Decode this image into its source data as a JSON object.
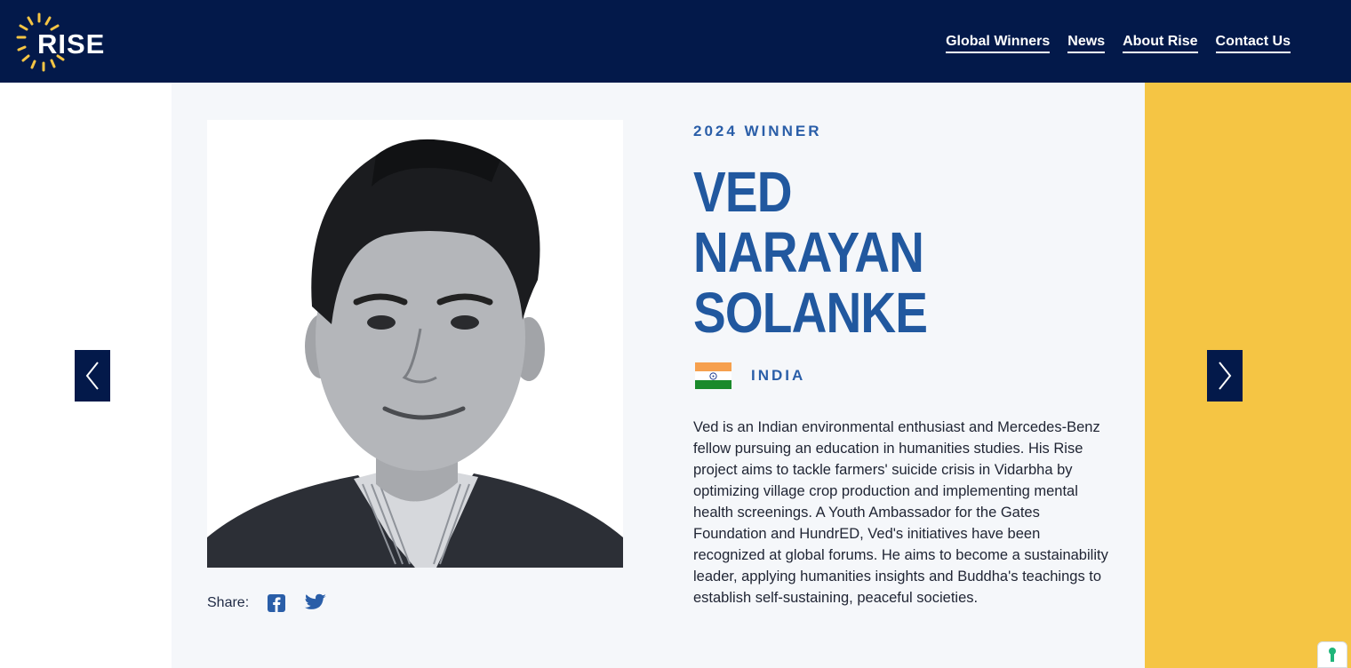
{
  "brand": {
    "logo_text": "RISE",
    "colors": {
      "navy": "#03194a",
      "blue": "#21589f",
      "yellow": "#f5c544",
      "panel": "#f5f7fa"
    }
  },
  "nav": {
    "items": [
      {
        "label": "Global Winners"
      },
      {
        "label": "News"
      },
      {
        "label": "About Rise"
      },
      {
        "label": "Contact Us"
      }
    ]
  },
  "profile": {
    "winner_tag": "2024 WINNER",
    "name_lines": [
      "VED",
      "NARAYAN",
      "SOLANKE"
    ],
    "country": "INDIA",
    "bio": "Ved is an Indian environmental enthusiast and Mercedes-Benz fellow pursuing an education in humanities studies. His Rise project aims to tackle farmers' suicide crisis in Vidarbha by optimizing village crop production and implementing mental health screenings. A Youth Ambassador for the Gates Foundation and HundrED, Ved's initiatives have been recognized at global forums. He aims to become a sustainability leader, applying humanities insights and Buddha's teachings to establish self-sustaining, peaceful societies."
  },
  "share": {
    "label": "Share:",
    "icons": [
      "facebook-icon",
      "twitter-icon"
    ]
  },
  "carousel": {
    "prev_icon": "chevron-left-icon",
    "next_icon": "chevron-right-icon"
  }
}
